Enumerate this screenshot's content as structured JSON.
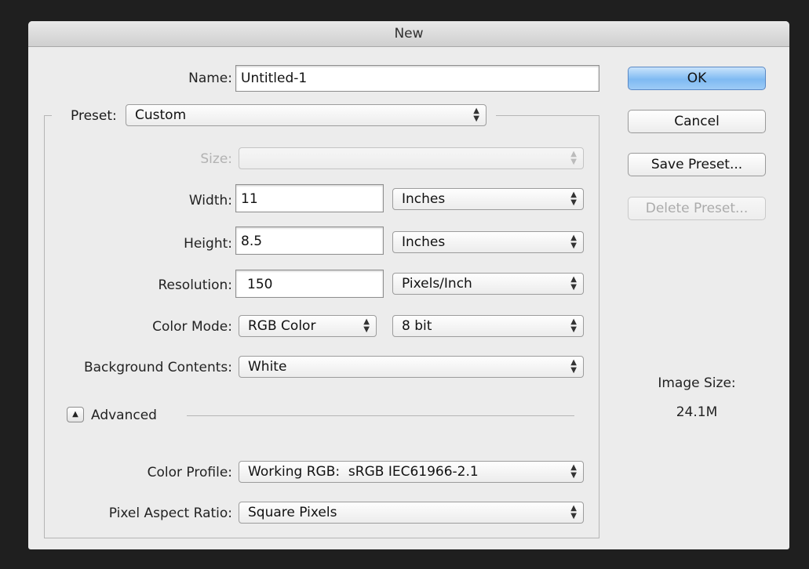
{
  "window": {
    "title": "New"
  },
  "name": {
    "label": "Name:",
    "value": "Untitled-1"
  },
  "preset": {
    "label": "Preset:",
    "value": "Custom"
  },
  "size": {
    "label": "Size:",
    "value": ""
  },
  "width": {
    "label": "Width:",
    "value": "11",
    "unit": "Inches"
  },
  "height": {
    "label": "Height:",
    "value": "8.5",
    "unit": "Inches"
  },
  "resolution": {
    "label": "Resolution:",
    "value": "150",
    "unit": "Pixels/Inch"
  },
  "color_mode": {
    "label": "Color Mode:",
    "value": "RGB Color",
    "depth": "8 bit"
  },
  "background": {
    "label": "Background Contents:",
    "value": "White"
  },
  "advanced": {
    "label": "Advanced"
  },
  "color_profile": {
    "label": "Color Profile:",
    "value": "Working RGB:  sRGB IEC61966-2.1"
  },
  "pixel_aspect": {
    "label": "Pixel Aspect Ratio:",
    "value": "Square Pixels"
  },
  "buttons": {
    "ok": "OK",
    "cancel": "Cancel",
    "save_preset": "Save Preset...",
    "delete_preset": "Delete Preset..."
  },
  "image_size": {
    "label": "Image Size:",
    "value": "24.1M"
  },
  "icons": {
    "popup": "up-down-arrows",
    "disclosure": "triangle-up"
  }
}
